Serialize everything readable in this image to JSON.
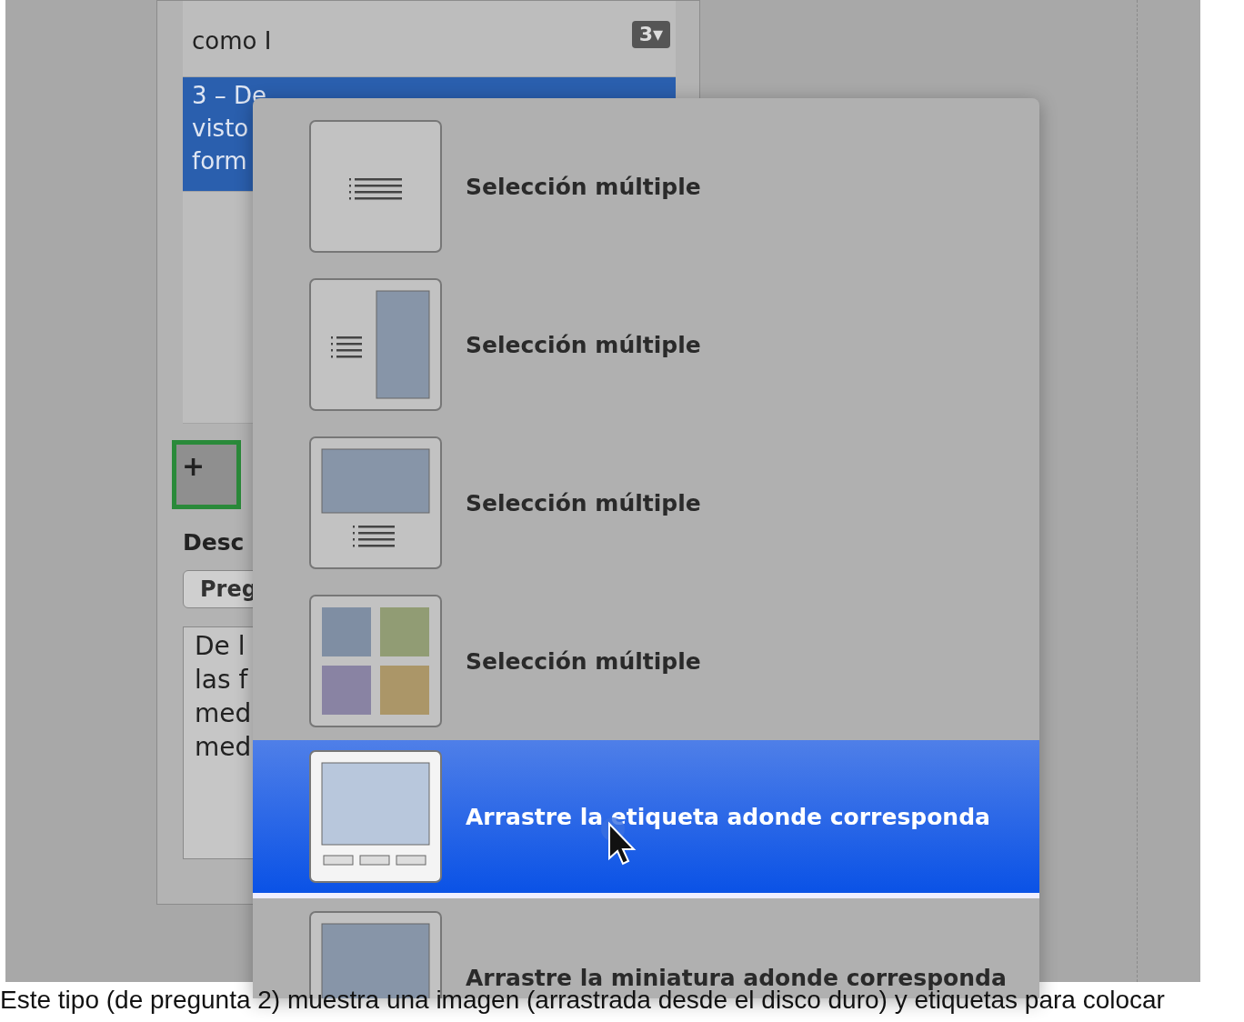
{
  "question_list": {
    "rows": [
      {
        "lines": [
          "como I"
        ],
        "badge": "3▾",
        "selected": false
      },
      {
        "lines": [
          "3 – De",
          "visto",
          "form"
        ],
        "selected": true
      }
    ]
  },
  "add_button": {
    "label": "+"
  },
  "description": {
    "label": "Desc",
    "popup": "Preg",
    "text_lines": [
      "De l",
      "las f",
      "med",
      "med"
    ]
  },
  "menu": {
    "items": [
      {
        "kind": "list",
        "label": "Selección múltiple",
        "selected": false
      },
      {
        "kind": "list-side",
        "label": "Selección múltiple",
        "selected": false
      },
      {
        "kind": "image-list",
        "label": "Selección múltiple",
        "selected": false
      },
      {
        "kind": "grid",
        "label": "Selección múltiple",
        "selected": false
      },
      {
        "kind": "image-labels",
        "label": "Arrastre la etiqueta adonde corresponda",
        "selected": true
      },
      {
        "kind": "image-thumbs",
        "label": "Arrastre la miniatura adonde corresponda",
        "selected": false
      }
    ]
  },
  "caption": "Este tipo (de pregunta 2) muestra una imagen (arrastrada desde el disco duro) y etiquetas para colocar"
}
